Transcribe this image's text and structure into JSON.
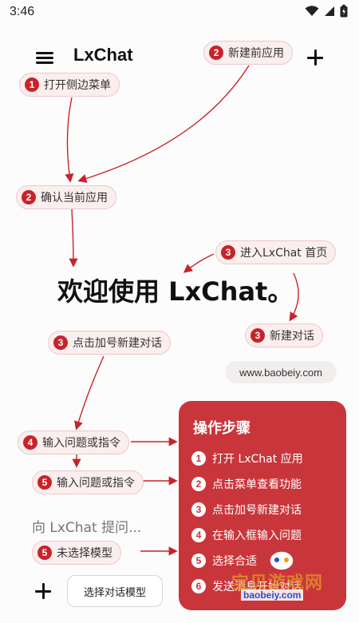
{
  "status_bar": {
    "time": "3:46"
  },
  "header": {
    "title": "LxChat"
  },
  "callouts": {
    "c_new_app": {
      "num": "2",
      "text": "新建前应用"
    },
    "c_open_menu": {
      "num": "1",
      "text": "打开侧边菜单"
    },
    "c_confirm": {
      "num": "2",
      "text": "确认当前应用"
    },
    "c_home": {
      "num": "3",
      "text": "进入LxChat 首页"
    },
    "c_new_chat": {
      "num": "3",
      "text": "新建对话"
    },
    "c_plus_new": {
      "num": "3",
      "text": "点击加号新建对话"
    },
    "c_input_q": {
      "num": "4",
      "text": "输入问题或指令"
    },
    "c_input_q2": {
      "num": "5",
      "text": "输入问题或指令"
    },
    "c_no_model": {
      "num": "5",
      "text": "未选择模型"
    }
  },
  "main": {
    "welcome": "欢迎使用 LxChat。"
  },
  "site": {
    "url": "www.baobeiy.com"
  },
  "steps": {
    "title": "操作步骤",
    "items": [
      {
        "num": "1",
        "text": "打开 LxChat 应用"
      },
      {
        "num": "2",
        "text": "点击菜单查看功能"
      },
      {
        "num": "3",
        "text": "点击加号新建对话"
      },
      {
        "num": "4",
        "text": "在输入框输入问题"
      },
      {
        "num": "5",
        "text": "选择合适"
      },
      {
        "num": "6",
        "text": "发送消息开始对话"
      }
    ]
  },
  "input": {
    "placeholder": "向 LxChat 提问..."
  },
  "bottom": {
    "model_button": "选择对话模型"
  },
  "watermark": {
    "text": "宝贝游戏网",
    "sub": "baobeiy.com"
  },
  "colors": {
    "accent": "#c8232a",
    "card": "#c8363b",
    "callout_bg": "#fbeeee"
  }
}
